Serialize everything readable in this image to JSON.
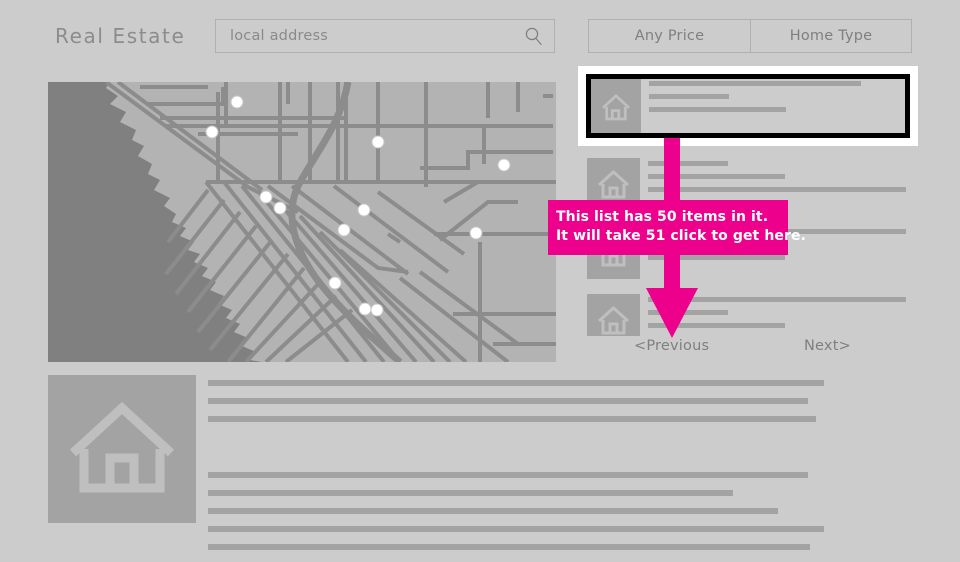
{
  "header": {
    "app_title": "Real Estate",
    "search": {
      "placeholder": "local address",
      "value": "",
      "icon": "search-icon"
    },
    "filters": [
      {
        "label": "Any Price"
      },
      {
        "label": "Home Type"
      }
    ]
  },
  "map": {
    "land_color": "#b3b3b3",
    "water_color": "#808080",
    "road_color": "#8c8c8c",
    "marker_color": "#ffffff",
    "marker_count": 12
  },
  "listings": {
    "rows": [
      {
        "icon": "house-icon",
        "selected": true
      },
      {
        "icon": "house-icon",
        "selected": false
      },
      {
        "icon": "house-icon",
        "selected": false
      },
      {
        "icon": "house-icon",
        "selected": false
      },
      {
        "icon": "house-icon",
        "selected": false
      }
    ],
    "highlight_border_color": "#000000",
    "highlight_frame_color": "#ffffff"
  },
  "pagination": {
    "previous_label": "<Previous",
    "next_label": "Next>"
  },
  "detail": {
    "icon": "house-icon"
  },
  "annotation": {
    "accent_color": "#ec008c",
    "line1": "This list has 50 items in it.",
    "line2": "It will take 51 click to get here.",
    "arrow": "down-arrow-icon"
  },
  "theme": {
    "background": "#cccccc",
    "placeholder_gray": "#a3a3a3",
    "text_gray": "#7f7f7f"
  }
}
